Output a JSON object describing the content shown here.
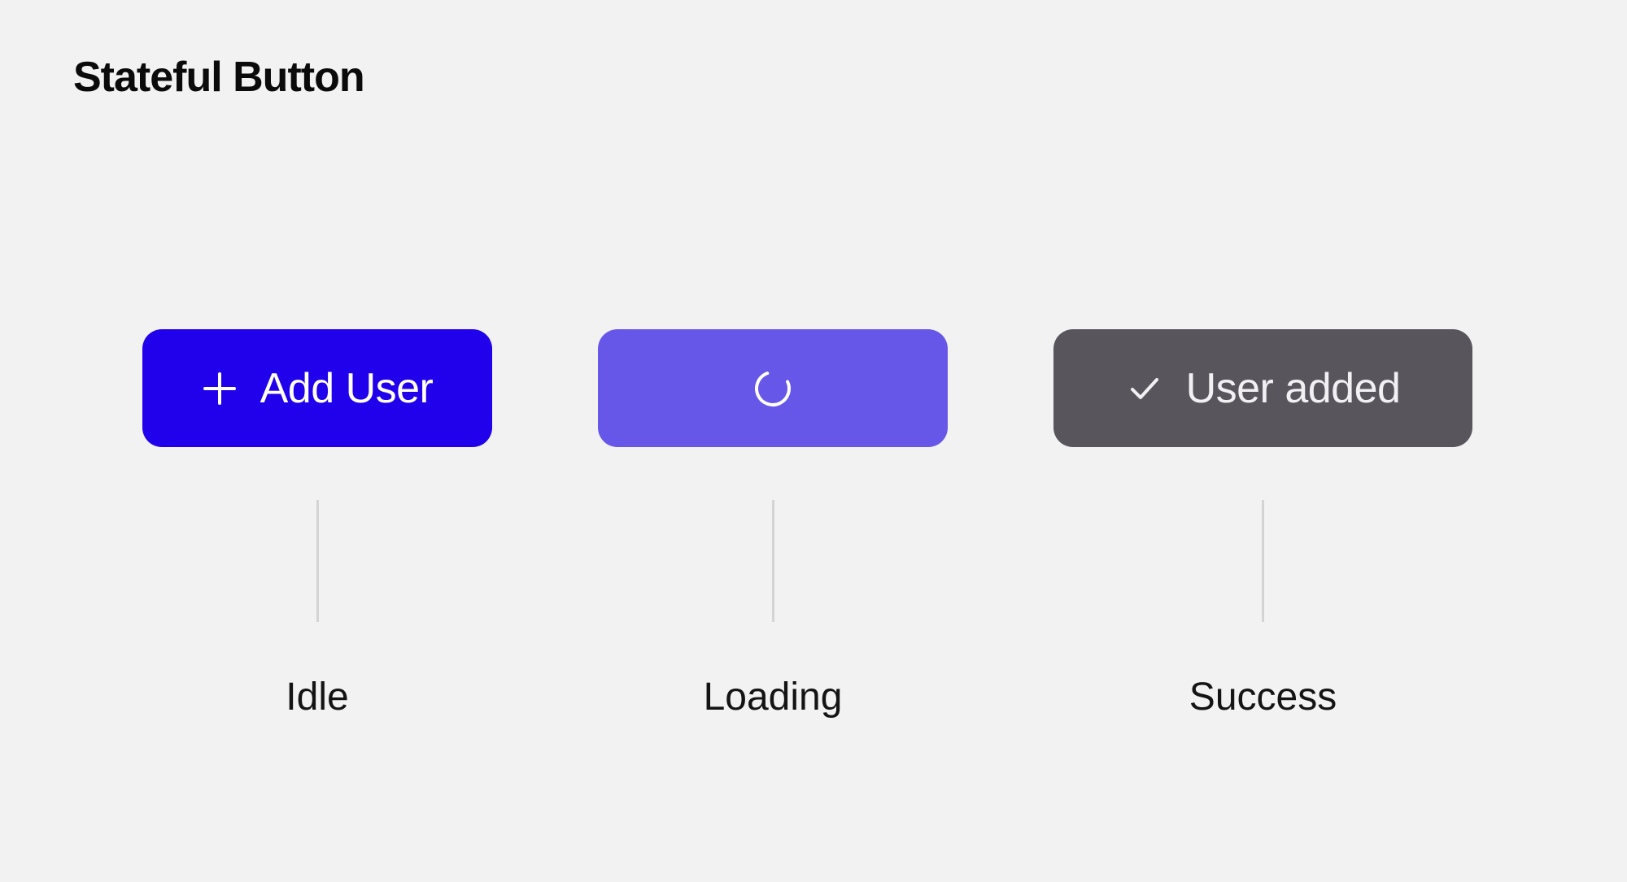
{
  "title": "Stateful Button",
  "states": {
    "idle": {
      "button_label": "Add User",
      "state_label": "Idle",
      "icon": "plus-icon",
      "bg_color": "#2100eb"
    },
    "loading": {
      "button_label": "",
      "state_label": "Loading",
      "icon": "spinner-icon",
      "bg_color": "#6757e8"
    },
    "success": {
      "button_label": "User added",
      "state_label": "Success",
      "icon": "check-icon",
      "bg_color": "#59555d"
    }
  }
}
